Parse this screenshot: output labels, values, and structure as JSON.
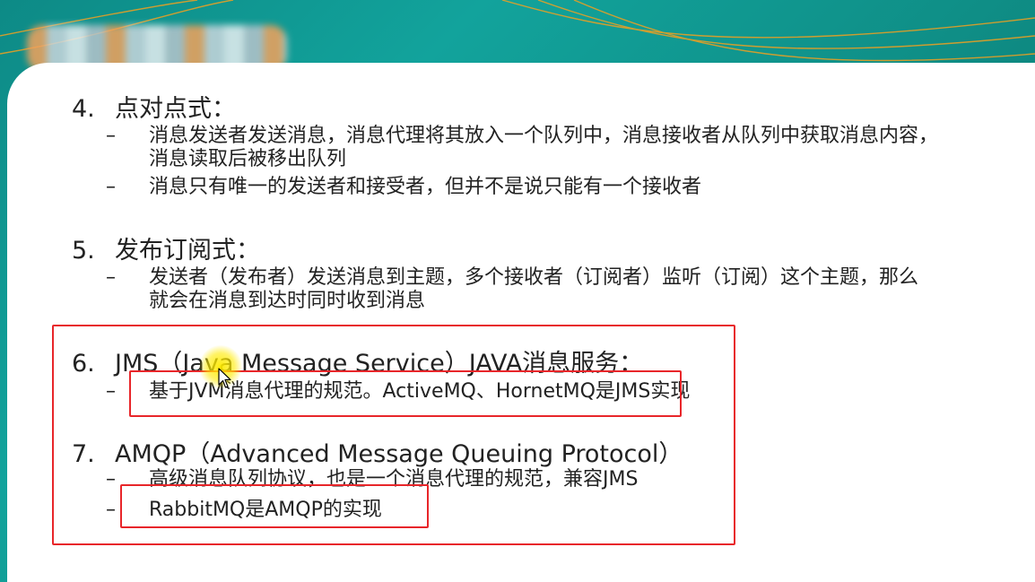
{
  "items": [
    {
      "num": "4.",
      "head": "点对点式：",
      "subs": [
        {
          "dash": "–",
          "lines": [
            "消息发送者发送消息，消息代理将其放入一个队列中，消息接收者从队列中获取消息内容，",
            "消息读取后被移出队列"
          ]
        },
        {
          "dash": "–",
          "lines": [
            "消息只有唯一的发送者和接受者，但并不是说只能有一个接收者"
          ]
        }
      ]
    },
    {
      "num": "5.",
      "head": "发布订阅式：",
      "subs": [
        {
          "dash": "–",
          "lines": [
            "发送者（发布者）发送消息到主题，多个接收者（订阅者）监听（订阅）这个主题，那么",
            "就会在消息到达时同时收到消息"
          ]
        }
      ]
    },
    {
      "num": "6.",
      "head": "JMS（Java Message Service）JAVA消息服务：",
      "subs": [
        {
          "dash": "–",
          "lines": [
            "基于JVM消息代理的规范。ActiveMQ、HornetMQ是JMS实现"
          ]
        }
      ]
    },
    {
      "num": "7.",
      "head": "AMQP（Advanced Message Queuing Protocol）",
      "subs": [
        {
          "dash": "–",
          "lines": [
            "高级消息队列协议，也是一个消息代理的规范，兼容JMS"
          ]
        },
        {
          "dash": "–",
          "lines": [
            "RabbitMQ是AMQP的实现"
          ]
        }
      ]
    }
  ],
  "colors": {
    "highlight_box": "#e8262a",
    "background": "#0d8a86",
    "cursor_glow": "#ffeb00"
  },
  "icons": {
    "cursor": "mouse-pointer-icon"
  }
}
